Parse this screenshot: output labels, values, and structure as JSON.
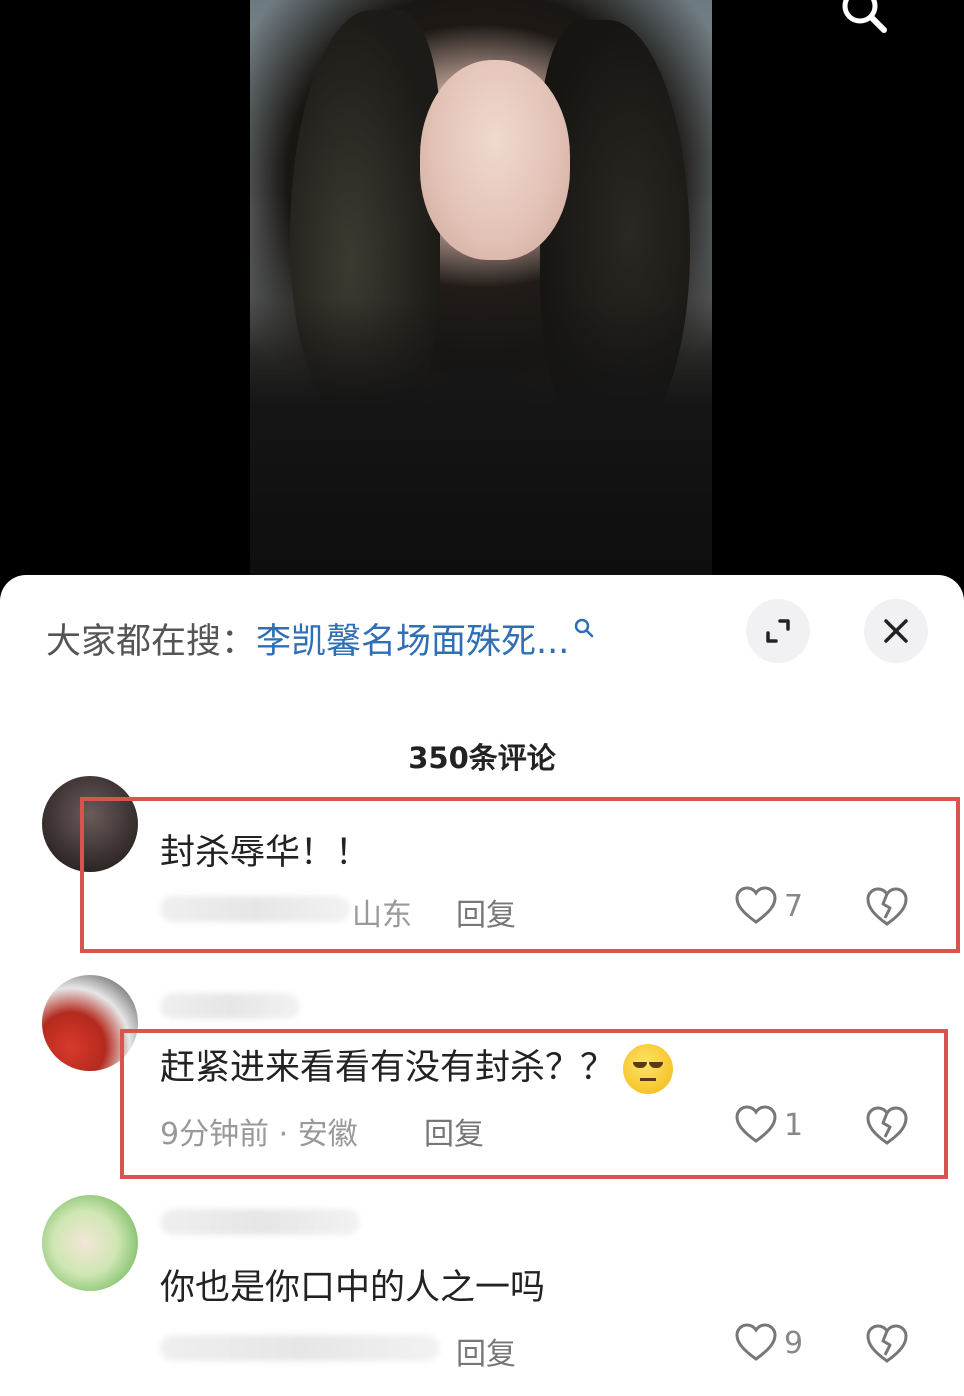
{
  "video": {
    "search_icon": "search-icon"
  },
  "sheet": {
    "hot_search_prefix": "大家都在搜：",
    "hot_search_link": "李凯馨名场面殊死...",
    "expand_icon": "expand-icon",
    "close_icon": "close-icon",
    "comment_count": "350条评论"
  },
  "comments": [
    {
      "text": "封杀辱华！！",
      "meta": "山东",
      "reply": "回复",
      "likes": "7"
    },
    {
      "text": "赶紧进来看看有没有封杀？？",
      "emoji": "unamused-face-emoji",
      "meta": "9分钟前 · 安徽",
      "reply": "回复",
      "likes": "1"
    },
    {
      "text": "你也是你口中的人之一吗",
      "reply": "回复",
      "likes": "9"
    }
  ],
  "colors": {
    "highlight": "#d9544f",
    "link": "#2f6fb5"
  }
}
